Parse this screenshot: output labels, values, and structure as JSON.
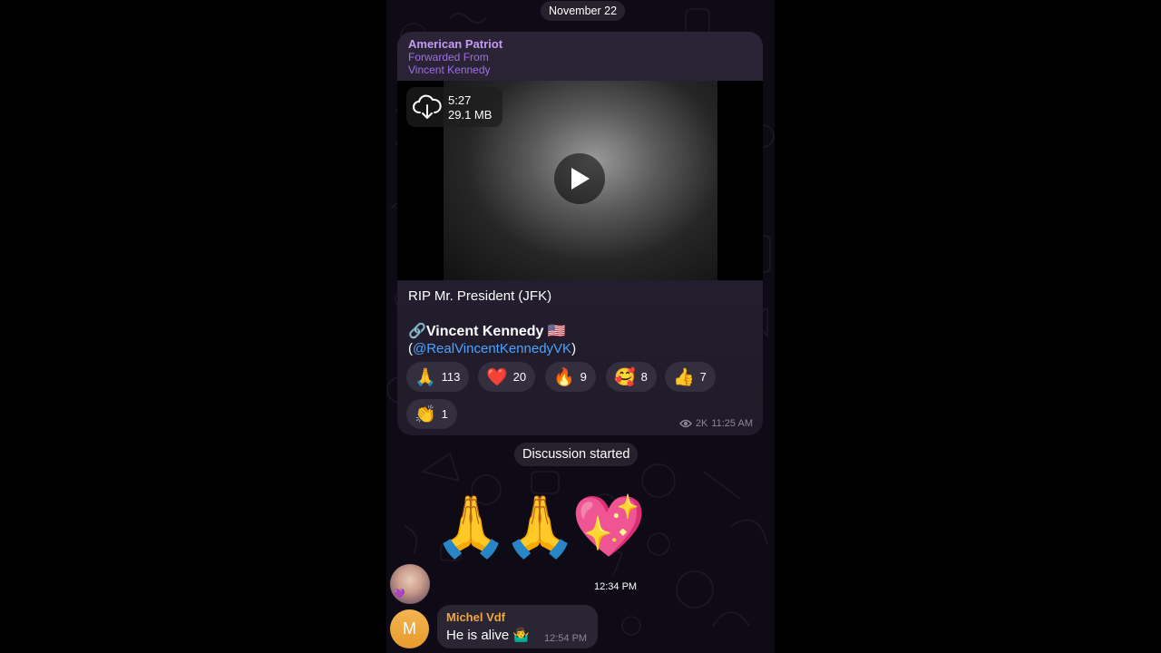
{
  "date_separator": "November 22",
  "post": {
    "channel_name": "American Patriot",
    "forwarded_label": "Forwarded From",
    "forwarded_source": "Vincent Kennedy",
    "video": {
      "duration": "5:27",
      "size": "29.1 MB",
      "download_icon": "cloud-download-icon",
      "play_icon": "play-icon"
    },
    "caption_line1": "RIP Mr. President (JFK)",
    "caption_link_emoji": "🔗",
    "caption_name": "Vincent Kennedy",
    "caption_flag": "🇺🇸",
    "caption_open_paren": "(",
    "caption_handle": "@RealVincentKennedyVK",
    "caption_close_paren": ")",
    "reactions": [
      {
        "emoji": "🙏",
        "count": "113"
      },
      {
        "emoji": "❤️",
        "count": "20"
      },
      {
        "emoji": "🔥",
        "count": "9"
      },
      {
        "emoji": "🥰",
        "count": "8"
      },
      {
        "emoji": "👍",
        "count": "7"
      },
      {
        "emoji": "👏",
        "count": "1"
      }
    ],
    "views": "2K",
    "time": "11:25 AM"
  },
  "discussion_label": "Discussion started",
  "messages": [
    {
      "content": "🙏🙏💖",
      "time": "12:34 PM",
      "badge": "💜"
    },
    {
      "avatar_letter": "M",
      "sender": "Michel Vdf",
      "text": "He is alive 🤷‍♂️",
      "time": "12:54 PM"
    }
  ],
  "colors": {
    "channel_name": "#c59af5",
    "forwarded": "#9f6fe6",
    "link": "#4ea2ff",
    "sender": "#f0a542"
  }
}
